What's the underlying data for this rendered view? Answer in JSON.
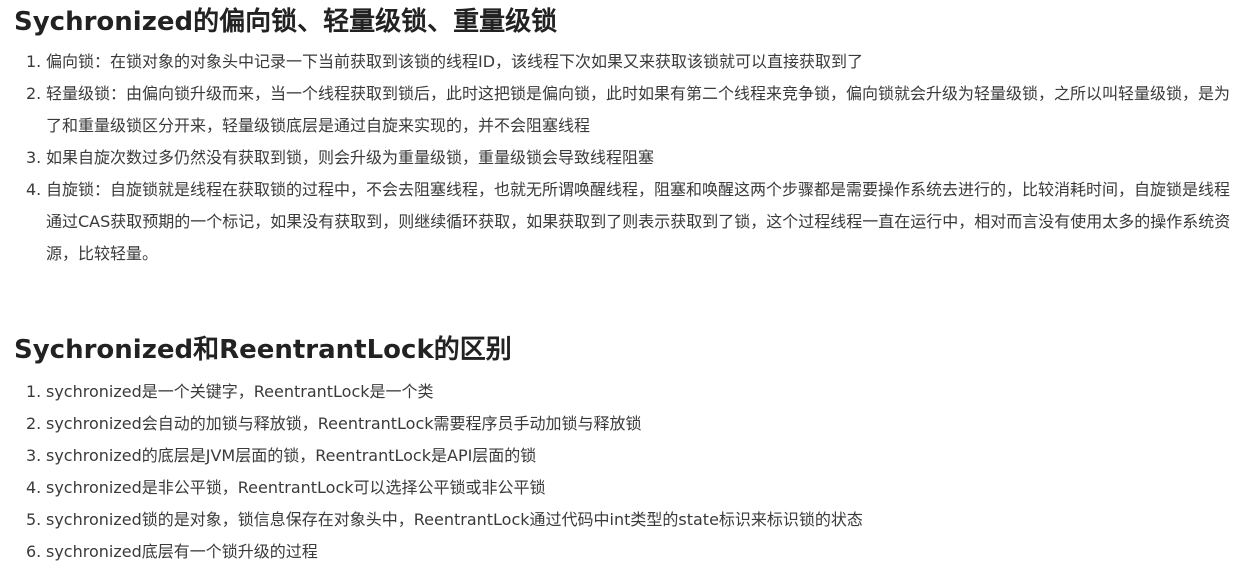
{
  "section1": {
    "title": "Sychronized的偏向锁、轻量级锁、重量级锁",
    "items": [
      {
        "num": "1.",
        "text": "偏向锁：在锁对象的对象头中记录一下当前获取到该锁的线程ID，该线程下次如果又来获取该锁就可以直接获取到了"
      },
      {
        "num": "2.",
        "text": "轻量级锁：由偏向锁升级而来，当一个线程获取到锁后，此时这把锁是偏向锁，此时如果有第二个线程来竞争锁，偏向锁就会升级为轻量级锁，之所以叫轻量级锁，是为了和重量级锁区分开来，轻量级锁底层是通过自旋来实现的，并不会阻塞线程"
      },
      {
        "num": "3.",
        "text": "如果自旋次数过多仍然没有获取到锁，则会升级为重量级锁，重量级锁会导致线程阻塞"
      },
      {
        "num": "4.",
        "text": "自旋锁：自旋锁就是线程在获取锁的过程中，不会去阻塞线程，也就无所谓唤醒线程，阻塞和唤醒这两个步骤都是需要操作系统去进行的，比较消耗时间，自旋锁是线程通过CAS获取预期的一个标记，如果没有获取到，则继续循环获取，如果获取到了则表示获取到了锁，这个过程线程一直在运行中，相对而言没有使用太多的操作系统资源，比较轻量。"
      }
    ]
  },
  "section2": {
    "title": "Sychronized和ReentrantLock的区别",
    "items": [
      {
        "num": "1.",
        "text": "sychronized是一个关键字，ReentrantLock是一个类"
      },
      {
        "num": "2.",
        "text": "sychronized会自动的加锁与释放锁，ReentrantLock需要程序员手动加锁与释放锁"
      },
      {
        "num": "3.",
        "text": "sychronized的底层是JVM层面的锁，ReentrantLock是API层面的锁"
      },
      {
        "num": "4.",
        "text": "sychronized是非公平锁，ReentrantLock可以选择公平锁或非公平锁"
      },
      {
        "num": "5.",
        "text": "sychronized锁的是对象，锁信息保存在对象头中，ReentrantLock通过代码中int类型的state标识来标识锁的状态"
      },
      {
        "num": "6.",
        "text": "sychronized底层有一个锁升级的过程"
      }
    ]
  }
}
